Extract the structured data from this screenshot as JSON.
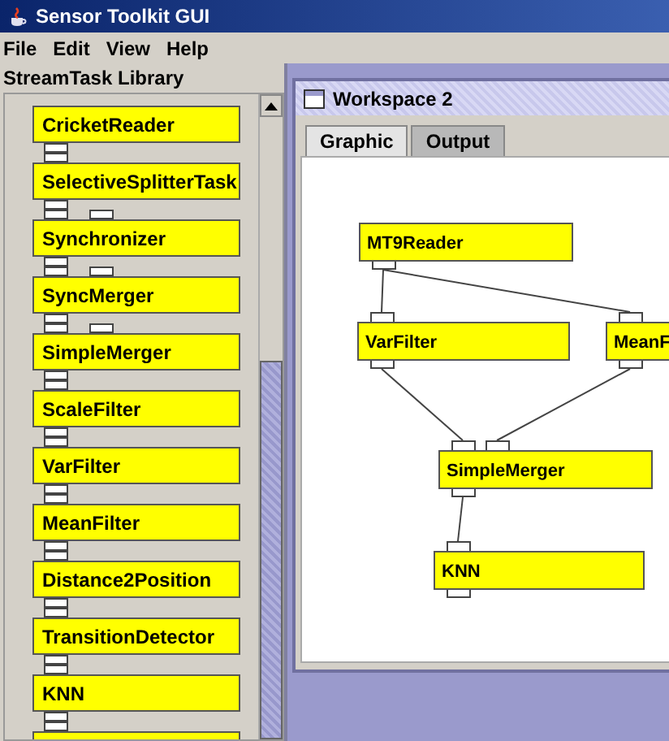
{
  "window": {
    "title": "Sensor Toolkit GUI"
  },
  "menu": [
    "File",
    "Edit",
    "View",
    "Help"
  ],
  "library": {
    "title": "StreamTask Library",
    "items": [
      {
        "label": "CricketReader",
        "kind": "single"
      },
      {
        "label": "SelectiveSplitterTask",
        "kind": "dual"
      },
      {
        "label": "Synchronizer",
        "kind": "dual"
      },
      {
        "label": "SyncMerger",
        "kind": "dual"
      },
      {
        "label": "SimpleMerger",
        "kind": "single"
      },
      {
        "label": "ScaleFilter",
        "kind": "single"
      },
      {
        "label": "VarFilter",
        "kind": "single"
      },
      {
        "label": "MeanFilter",
        "kind": "single"
      },
      {
        "label": "Distance2Position",
        "kind": "single"
      },
      {
        "label": "TransitionDetector",
        "kind": "single"
      },
      {
        "label": "KNN",
        "kind": "single"
      }
    ]
  },
  "workspace": {
    "title": "Workspace 2",
    "tabs": [
      {
        "label": "Graphic",
        "selected": true
      },
      {
        "label": "Output",
        "selected": false
      }
    ],
    "nodes": [
      {
        "label": "MT9Reader"
      },
      {
        "label": "VarFilter"
      },
      {
        "label": "MeanF"
      },
      {
        "label": "SimpleMerger"
      },
      {
        "label": "KNN"
      }
    ]
  }
}
